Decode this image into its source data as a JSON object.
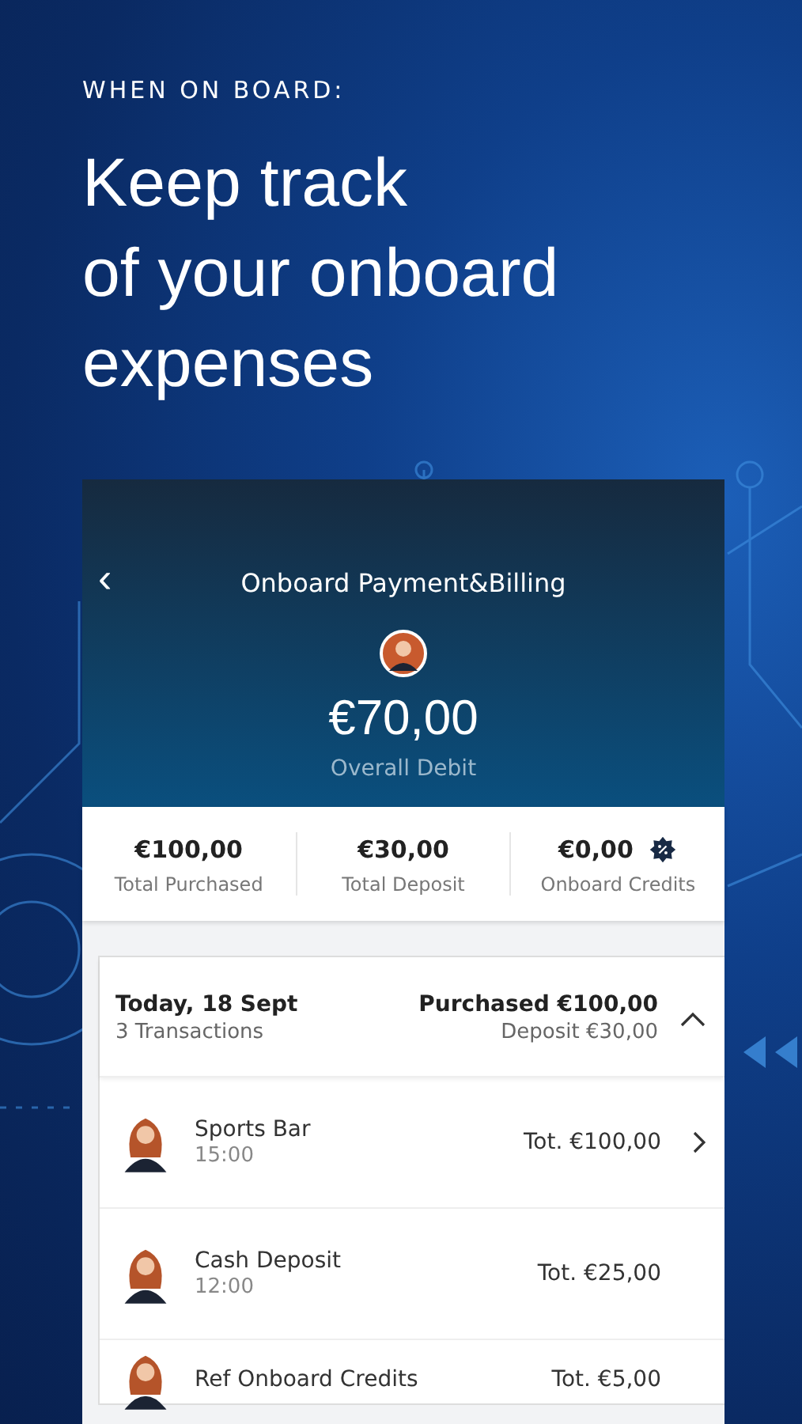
{
  "eyebrow": "WHEN ON BOARD:",
  "headline": [
    "Keep track",
    "of your onboard",
    "expenses"
  ],
  "screen": {
    "title": "Onboard Payment&Billing",
    "back": "‹",
    "amount": "€70,00",
    "amount_label": "Overall Debit",
    "stats": [
      {
        "value": "€100,00",
        "label": "Total Purchased",
        "badge": false
      },
      {
        "value": "€30,00",
        "label": "Total Deposit",
        "badge": false
      },
      {
        "value": "€0,00",
        "label": "Onboard Credits",
        "badge": true
      }
    ],
    "group": {
      "date": "Today, 18 Sept",
      "count": "3 Transactions",
      "purchased": "Purchased €100,00",
      "deposit": "Deposit €30,00",
      "expanded": true,
      "transactions": [
        {
          "name": "Sports Bar",
          "time": "15:00",
          "total": "Tot. €100,00",
          "arrow": true
        },
        {
          "name": "Cash Deposit",
          "time": "12:00",
          "total": "Tot. €25,00",
          "arrow": false
        },
        {
          "name": "Ref Onboard Credits",
          "total": "Tot. €5,00",
          "arrow": false
        }
      ]
    }
  }
}
